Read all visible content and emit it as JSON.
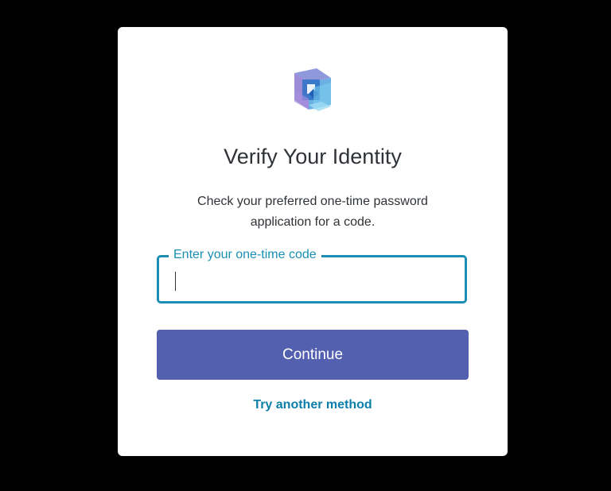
{
  "colors": {
    "background": "#000000",
    "card": "#ffffff",
    "accent": "#1a8fb3",
    "button": "#5360b0",
    "link": "#0b7fa8",
    "text": "#2f3337"
  },
  "logo": {
    "icon": "cube-logo-icon"
  },
  "heading": {
    "title": "Verify Your Identity"
  },
  "description": {
    "line1": "Check your preferred one-time password",
    "line2": "application for a code."
  },
  "otp_field": {
    "label": "Enter your one-time code",
    "value": ""
  },
  "actions": {
    "continue_label": "Continue",
    "alternate_label": "Try another method"
  }
}
